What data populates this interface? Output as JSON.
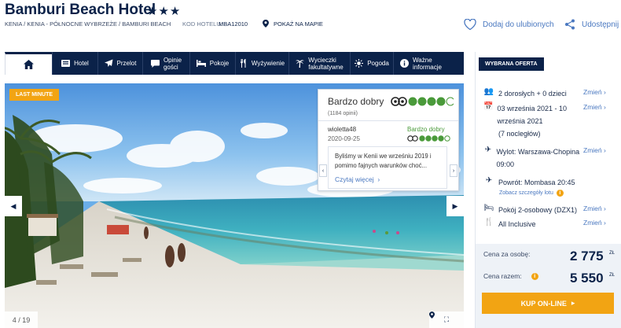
{
  "header": {
    "title": "Bamburi Beach Hotel",
    "stars": "★★★",
    "breadcrumb": "KENIA / KENIA - PÓŁNOCNE WYBRZEŻE / BAMBURI BEACH",
    "code_label": "KOD HOTELU:",
    "code_value": "MBA12010",
    "map_link": "POKAŻ NA MAPIE",
    "favorite_label": "Dodaj do ulubionych",
    "share_label": "Udostępnij"
  },
  "nav": {
    "items": [
      {
        "label": "Hotel",
        "icon": "hotel-icon"
      },
      {
        "label": "Przelot",
        "icon": "plane-icon"
      },
      {
        "label": "Opinie\ngości",
        "icon": "chat-icon"
      },
      {
        "label": "Pokoje",
        "icon": "bed-icon"
      },
      {
        "label": "Wyżywienie",
        "icon": "cutlery-icon"
      },
      {
        "label": "Wycieczki\nfakultatywne",
        "icon": "palm-icon"
      },
      {
        "label": "Pogoda",
        "icon": "sun-icon"
      },
      {
        "label": "Ważne\ninformacje",
        "icon": "info-icon"
      }
    ]
  },
  "photo": {
    "badge": "LAST MINUTE",
    "counter": "4 / 19"
  },
  "tripadvisor": {
    "rating_text": "Bardzo dobry",
    "review_count": "(1184 opinii)",
    "score_circles": 4,
    "review": {
      "user": "wioletta48",
      "date": "2020-09-25",
      "rating_text": "Bardzo dobry",
      "score_circles": 4,
      "text": "Byliśmy w Kenii we wrześniu 2019 i pomimo fajnych warunków choć...",
      "more_link": "Czytaj więcej"
    }
  },
  "offer": {
    "title": "WYBRANA OFERTA",
    "change_label": "Zmień",
    "travellers": "2 dorosłych + 0 dzieci",
    "dates": "03 września 2021 - 10 września 2021",
    "nights": "(7 nocległów)",
    "departure": "Wylot: Warszawa-Chopina 09:00",
    "return": "Powrót: Mombasa 20:45",
    "flight_details_link": "Zobacz szczegóły lotu",
    "room": "Pokój 2-osobowy (DZX1)",
    "board": "All Inclusive",
    "price_per_person_label": "Cena za osobę:",
    "price_per_person": "2 775",
    "price_total_label": "Cena razem:",
    "price_total": "5 550",
    "currency": "ZŁ",
    "buy_button": "KUP ON-LINE"
  },
  "colors": {
    "navy": "#0b2249",
    "accent": "#f2a413",
    "link": "#4a78c0",
    "tripadvisor_green": "#4a9a3a"
  }
}
